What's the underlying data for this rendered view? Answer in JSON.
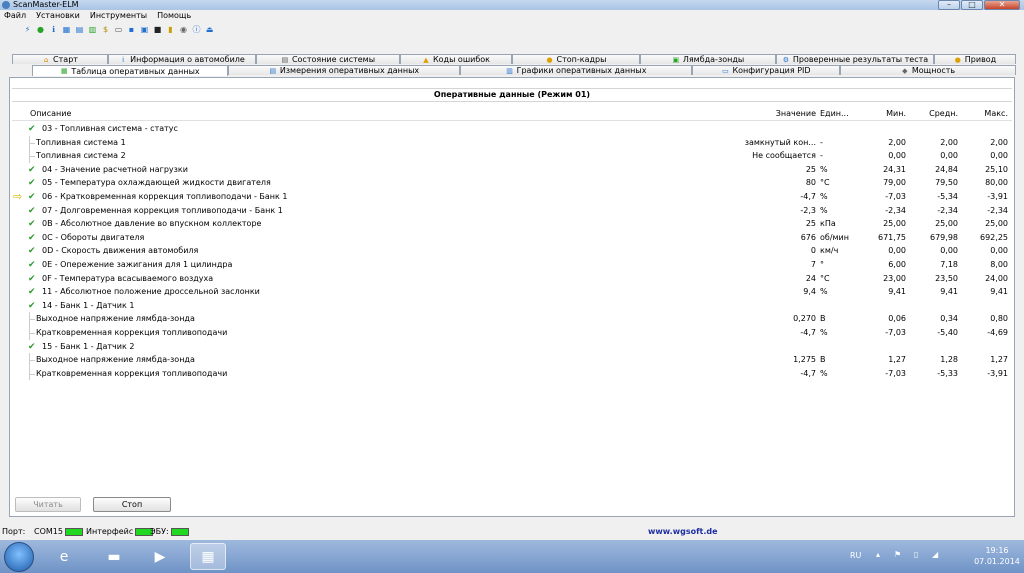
{
  "window": {
    "title": "ScanMaster-ELM",
    "minimize": "–",
    "maximize": "□",
    "close": "✕"
  },
  "menu": [
    "Файл",
    "Установки",
    "Инструменты",
    "Помощь"
  ],
  "tabs_row1": [
    {
      "label": "Старт",
      "icon": "house-icon"
    },
    {
      "label": "Информация о автомобиле",
      "icon": "info-icon"
    },
    {
      "label": "Состояние системы",
      "icon": "grid-icon"
    },
    {
      "label": "Коды ошибок",
      "icon": "warning-icon"
    },
    {
      "label": "Стоп-кадры",
      "icon": "freeze-icon"
    },
    {
      "label": "Лямбда-зонды",
      "icon": "sensor-icon"
    },
    {
      "label": "Проверенные результаты теста",
      "icon": "gear-icon"
    },
    {
      "label": "Привод",
      "icon": "drive-icon"
    }
  ],
  "tabs_row2": [
    {
      "label": "Таблица оперативных данных",
      "icon": "table-icon",
      "active": true
    },
    {
      "label": "Измерения оперативных данных",
      "icon": "meter-icon"
    },
    {
      "label": "Графики оперативных данных",
      "icon": "chart-icon"
    },
    {
      "label": "Конфигурация PID",
      "icon": "config-icon"
    },
    {
      "label": "Мощность",
      "icon": "power-icon"
    }
  ],
  "grid": {
    "title": "Оперативные данные (Режим 01)",
    "headers": {
      "desc": "Описание",
      "value": "Значение",
      "unit": "Един...",
      "min": "Мин.",
      "avg": "Средн.",
      "max": "Макс."
    },
    "rows": [
      {
        "desc": "03 - Топливная система - статус",
        "level": 0,
        "check": true,
        "value": "",
        "unit": "",
        "min": "",
        "avg": "",
        "max": ""
      },
      {
        "desc": "Топливная система 1",
        "level": 1,
        "check": false,
        "value": "замкнутый кон...",
        "unit": "-",
        "min": "2,00",
        "avg": "2,00",
        "max": "2,00"
      },
      {
        "desc": "Топливная система 2",
        "level": 1,
        "check": false,
        "value": "Не сообщается",
        "unit": "-",
        "min": "0,00",
        "avg": "0,00",
        "max": "0,00"
      },
      {
        "desc": "04 - Значение расчетной нагрузки",
        "level": 0,
        "check": true,
        "value": "25",
        "unit": "%",
        "min": "24,31",
        "avg": "24,84",
        "max": "25,10"
      },
      {
        "desc": "05 - Температура охлаждающей жидкости двигателя",
        "level": 0,
        "check": true,
        "value": "80",
        "unit": "°C",
        "min": "79,00",
        "avg": "79,50",
        "max": "80,00"
      },
      {
        "desc": "06 - Кратковременная коррекция топливоподачи - Банк 1",
        "level": 0,
        "check": true,
        "arrow": true,
        "value": "-4,7",
        "unit": "%",
        "min": "-7,03",
        "avg": "-5,34",
        "max": "-3,91"
      },
      {
        "desc": "07 - Долговременная коррекция топливоподачи - Банк 1",
        "level": 0,
        "check": true,
        "value": "-2,3",
        "unit": "%",
        "min": "-2,34",
        "avg": "-2,34",
        "max": "-2,34"
      },
      {
        "desc": "0B - Абсолютное давление во впускном коллекторе",
        "level": 0,
        "check": true,
        "value": "25",
        "unit": "кПа",
        "min": "25,00",
        "avg": "25,00",
        "max": "25,00"
      },
      {
        "desc": "0C - Обороты двигателя",
        "level": 0,
        "check": true,
        "value": "676",
        "unit": "об/мин",
        "min": "671,75",
        "avg": "679,98",
        "max": "692,25"
      },
      {
        "desc": "0D - Скорость движения автомобиля",
        "level": 0,
        "check": true,
        "value": "0",
        "unit": "км/ч",
        "min": "0,00",
        "avg": "0,00",
        "max": "0,00"
      },
      {
        "desc": "0E - Опережение зажигания для 1 цилиндра",
        "level": 0,
        "check": true,
        "value": "7",
        "unit": "°",
        "min": "6,00",
        "avg": "7,18",
        "max": "8,00"
      },
      {
        "desc": "0F - Температура всасываемого воздуха",
        "level": 0,
        "check": true,
        "value": "24",
        "unit": "°C",
        "min": "23,00",
        "avg": "23,50",
        "max": "24,00"
      },
      {
        "desc": "11 - Абсолютное положение дроссельной заслонки",
        "level": 0,
        "check": true,
        "value": "9,4",
        "unit": "%",
        "min": "9,41",
        "avg": "9,41",
        "max": "9,41"
      },
      {
        "desc": "14 - Банк 1 - Датчик 1",
        "level": 0,
        "check": true,
        "value": "",
        "unit": "",
        "min": "",
        "avg": "",
        "max": ""
      },
      {
        "desc": "Выходное напряжение лямбда-зонда",
        "level": 1,
        "check": false,
        "value": "0,270",
        "unit": "В",
        "min": "0,06",
        "avg": "0,34",
        "max": "0,80"
      },
      {
        "desc": "Кратковременная коррекция топливоподачи",
        "level": 1,
        "check": false,
        "value": "-4,7",
        "unit": "%",
        "min": "-7,03",
        "avg": "-5,40",
        "max": "-4,69"
      },
      {
        "desc": "15 - Банк 1 - Датчик 2",
        "level": 0,
        "check": true,
        "value": "",
        "unit": "",
        "min": "",
        "avg": "",
        "max": ""
      },
      {
        "desc": "Выходное напряжение лямбда-зонда",
        "level": 1,
        "check": false,
        "value": "1,275",
        "unit": "В",
        "min": "1,27",
        "avg": "1,28",
        "max": "1,27"
      },
      {
        "desc": "Кратковременная коррекция топливоподачи",
        "level": 1,
        "check": false,
        "value": "-4,7",
        "unit": "%",
        "min": "-7,03",
        "avg": "-5,33",
        "max": "-3,91"
      }
    ]
  },
  "buttons": {
    "read": "Читать",
    "stop": "Стоп"
  },
  "status": {
    "port_label": "Порт:",
    "port_value": "COM15",
    "interface_label": "Интерфейс",
    "ecu_label": "ЭБУ:",
    "link": "www.wgsoft.de",
    "led_color": "#1fd81f"
  },
  "taskbar": {
    "lang": "RU",
    "time": "19:16",
    "date": "07.01.2014"
  }
}
